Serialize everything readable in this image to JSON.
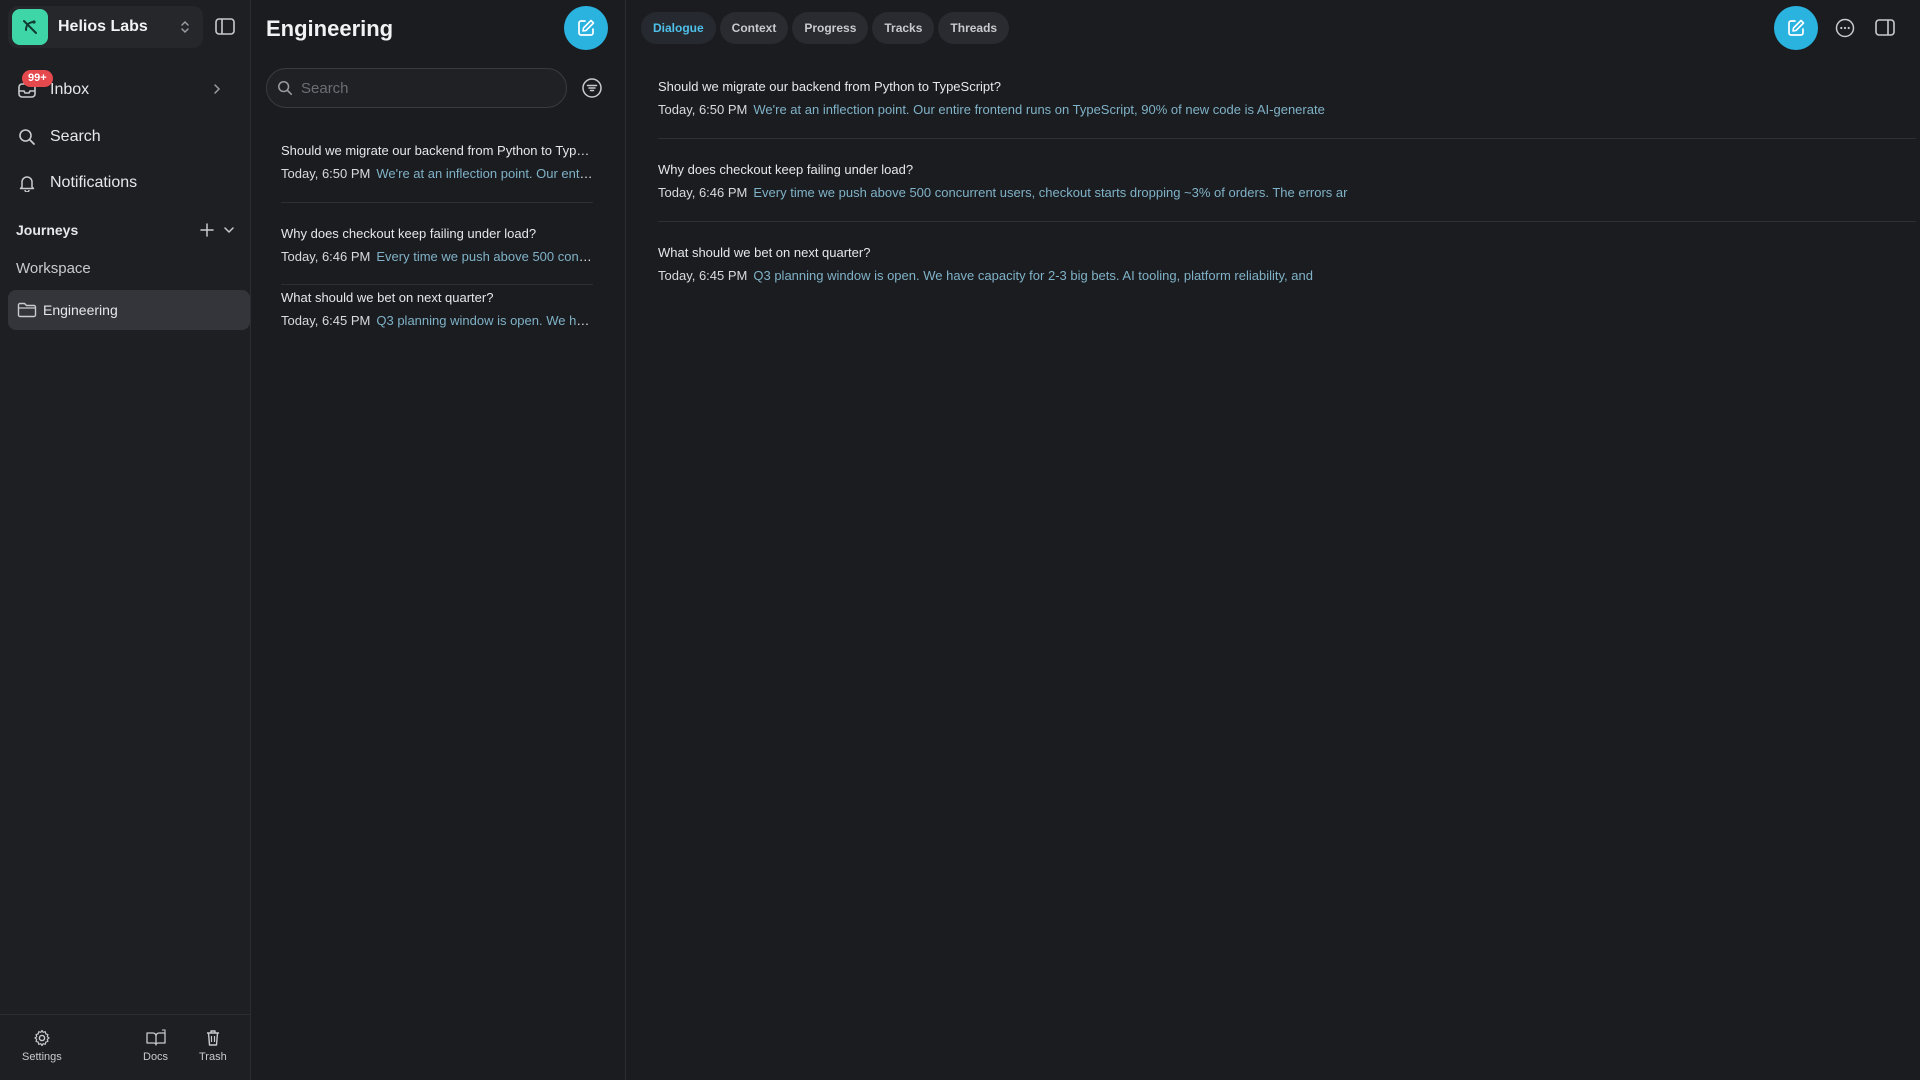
{
  "colors": {
    "accent": "#2bb3e0",
    "brand": "#3fd6a7",
    "badge": "#e5484d",
    "preview": "#7fb2c8"
  },
  "sidebar": {
    "workspace_name": "Helios Labs",
    "inbox_label": "Inbox",
    "inbox_badge": "99+",
    "search_label": "Search",
    "notifications_label": "Notifications",
    "journeys_label": "Journeys",
    "workspace_section": "Workspace",
    "folder_label": "Engineering",
    "footer": {
      "settings": "Settings",
      "docs": "Docs",
      "trash": "Trash"
    }
  },
  "list": {
    "title": "Engineering",
    "search_placeholder": "Search",
    "threads": [
      {
        "title": "Should we migrate our backend from Python to TypeScript?",
        "date": "Today, 6:50 PM",
        "preview": "We're at an inflection point. Our entire frontend runs on TypeScript, 90% of new code is AI-generate"
      },
      {
        "title": "Why does checkout keep failing under load?",
        "date": "Today, 6:46 PM",
        "preview": "Every time we push above 500 concurrent users, checkout starts dropping ~3% of orders. The errors ar"
      },
      {
        "title": "What should we bet on next quarter?",
        "date": "Today, 6:45 PM",
        "preview": "Q3 planning window is open. We have capacity for 2-3 big bets. AI tooling, platform reliability, and"
      }
    ]
  },
  "main": {
    "tabs": [
      "Dialogue",
      "Context",
      "Progress",
      "Tracks",
      "Threads"
    ],
    "active_tab": "Dialogue"
  }
}
